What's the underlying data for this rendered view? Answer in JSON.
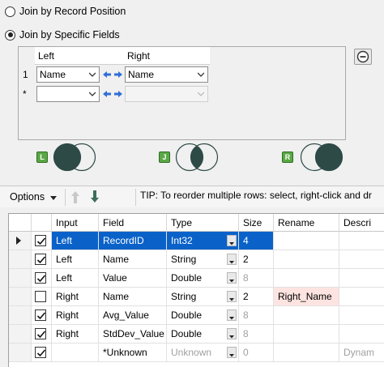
{
  "join_mode": {
    "options": [
      {
        "label": "Join by Record Position",
        "selected": false
      },
      {
        "label": "Join by Specific Fields",
        "selected": true
      }
    ]
  },
  "join_fields": {
    "headers": {
      "left": "Left",
      "right": "Right"
    },
    "rows": [
      {
        "row_header": "1",
        "left": "Name",
        "right": "Name"
      },
      {
        "row_header": "*",
        "left": "",
        "right": ""
      }
    ]
  },
  "venn_anchors": [
    {
      "badge": "L",
      "highlight": "left"
    },
    {
      "badge": "J",
      "highlight": "inner"
    },
    {
      "badge": "R",
      "highlight": "right"
    }
  ],
  "toolbar": {
    "options_label": "Options",
    "tip": "TIP: To reorder multiple rows: select, right-click and dr"
  },
  "table": {
    "columns": [
      "Input",
      "Field",
      "Type",
      "Size",
      "Rename",
      "Descri"
    ],
    "rows": [
      {
        "checked": true,
        "input": "Left",
        "field": "RecordID",
        "type": "Int32",
        "size": "4",
        "rename": "",
        "description": "",
        "selected": true,
        "size_muted": false
      },
      {
        "checked": true,
        "input": "Left",
        "field": "Name",
        "type": "String",
        "size": "2",
        "rename": "",
        "description": "",
        "selected": false,
        "size_muted": false
      },
      {
        "checked": true,
        "input": "Left",
        "field": "Value",
        "type": "Double",
        "size": "8",
        "rename": "",
        "description": "",
        "selected": false,
        "size_muted": true
      },
      {
        "checked": false,
        "input": "Right",
        "field": "Name",
        "type": "String",
        "size": "2",
        "rename": "Right_Name",
        "description": "",
        "selected": false,
        "size_muted": false
      },
      {
        "checked": true,
        "input": "Right",
        "field": "Avg_Value",
        "type": "Double",
        "size": "8",
        "rename": "",
        "description": "",
        "selected": false,
        "size_muted": true
      },
      {
        "checked": true,
        "input": "Right",
        "field": "StdDev_Value",
        "type": "Double",
        "size": "8",
        "rename": "",
        "description": "",
        "selected": false,
        "size_muted": true
      },
      {
        "checked": true,
        "input": "",
        "field": "*Unknown",
        "type": "Unknown",
        "size": "0",
        "rename": "",
        "description": "Dynam",
        "selected": false,
        "size_muted": true
      }
    ]
  },
  "colors": {
    "selection": "#0a62c9",
    "rename_highlight": "#fde4e1",
    "venn_fill": "#2d4a46",
    "anchor_green": "#5aa845"
  }
}
